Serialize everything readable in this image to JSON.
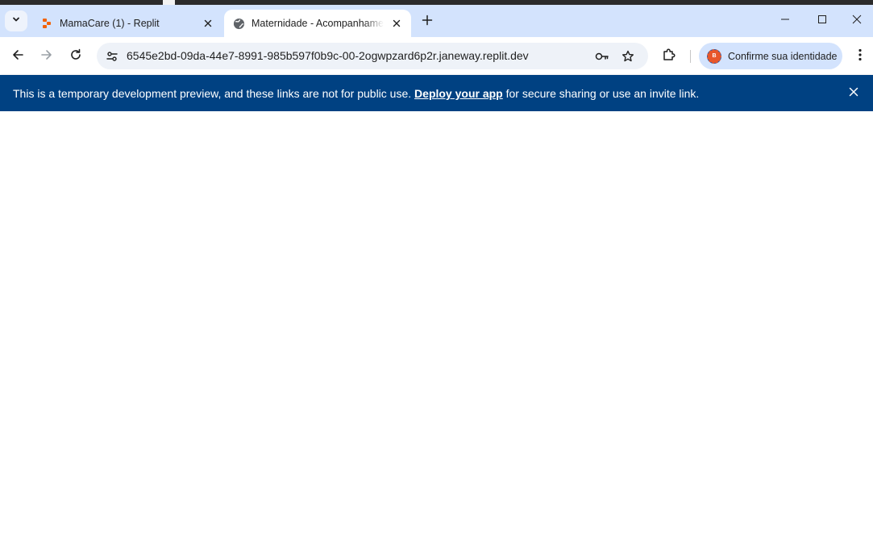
{
  "tabs": [
    {
      "title": "MamaCare (1) - Replit",
      "active": false,
      "icon": "replit-icon"
    },
    {
      "title": "Maternidade - Acompanhamento",
      "active": true,
      "icon": "globe-icon"
    }
  ],
  "address_bar": {
    "url": "6545e2bd-09da-44e7-8991-985b597f0b9c-00-2ogwpzard6p2r.janeway.replit.dev"
  },
  "profile": {
    "label": "Confirme sua identidade",
    "avatar_letter": "B"
  },
  "banner": {
    "text_before": "This is a temporary development preview, and these links are not for public use.",
    "link_text": "Deploy your app",
    "text_after": "for secure sharing or use an invite link."
  },
  "colors": {
    "tabstrip": "#d3e3fd",
    "banner": "#004182",
    "omnibox": "#eef2f8"
  }
}
